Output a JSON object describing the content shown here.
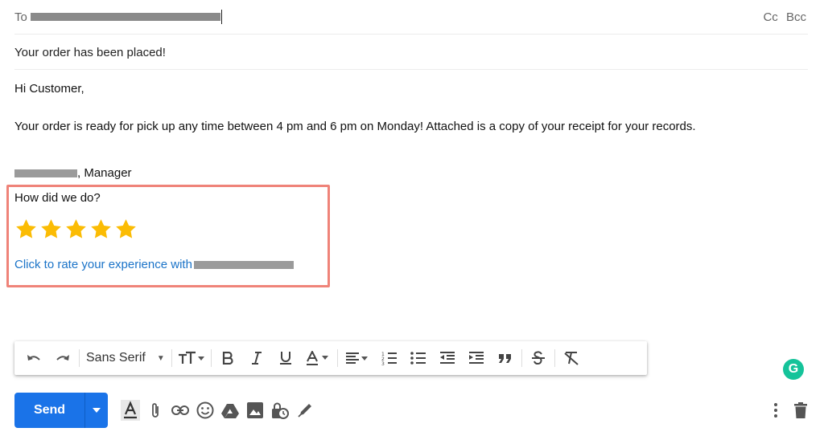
{
  "recipients": {
    "to_label": "To",
    "cc_label": "Cc",
    "bcc_label": "Bcc"
  },
  "subject": "Your order has been placed!",
  "body": {
    "greeting": "Hi Customer,",
    "message": "Your order is ready for pick up any time between 4 pm and 6 pm on Monday! Attached is a copy of your receipt for your records.",
    "signature_suffix": ", Manager"
  },
  "rating": {
    "question": "How did we do?",
    "stars_total": 5,
    "stars_filled": 5,
    "link_text": "Click to rate your experience with",
    "star_color": "#fbbc04",
    "highlight_color": "#ef8379"
  },
  "formatting_toolbar": {
    "font_name": "Sans Serif",
    "icons": [
      "undo-icon",
      "redo-icon",
      "text-size-icon",
      "bold-icon",
      "italic-icon",
      "underline-icon",
      "text-color-icon",
      "align-icon",
      "numbered-list-icon",
      "bulleted-list-icon",
      "indent-less-icon",
      "indent-more-icon",
      "quote-icon",
      "strikethrough-icon",
      "remove-formatting-icon"
    ]
  },
  "actions": {
    "send_label": "Send",
    "send_color": "#1a73e8",
    "grammarly_letter": "G",
    "grammarly_color": "#15c39a"
  }
}
